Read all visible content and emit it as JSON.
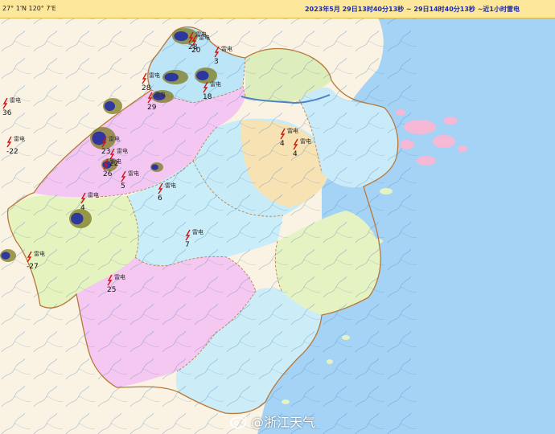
{
  "header": {
    "coordinates": "27° 1'N  120° 7'E",
    "timestamp": "2023年5月 29日13时40分13秒 ~ 29日14时40分13秒 ~近1小时雷电"
  },
  "watermark": {
    "text": "@浙江天气",
    "icon": "weibo-logo-icon"
  },
  "legend_word": "雷电",
  "colors": {
    "sea": "#a5d3f5",
    "land_outside": "#faf3e3",
    "hangzhou": "#f4c7f2",
    "huzhou": "#bde5f8",
    "jiaxing": "#ddedbc",
    "shaoxing": "#c7ebf7",
    "ningbo": "#c9ebf9",
    "quzhou": "#e5f3bf",
    "jinhua": "#c9edf9",
    "lishui": "#f4c8f0",
    "taizhou": "#e4f3c1",
    "wenzhou": "#ccedf8",
    "zhoushan": "#f5b8d5",
    "tan_zone": "#f6e2b2",
    "river": "#4d82c2",
    "border": "#b7783a",
    "lightning": "#d61212",
    "cluster_olive": "#7c7a1d",
    "cluster_blue": "#1521b0"
  },
  "strike_labels": [
    {
      "id": "l1",
      "text": "28"
    },
    {
      "id": "l2",
      "text": "28"
    },
    {
      "id": "l3",
      "text": "3"
    },
    {
      "id": "l4",
      "text": "18"
    },
    {
      "id": "l5",
      "text": "29"
    },
    {
      "id": "l6",
      "text": "20"
    },
    {
      "id": "l7",
      "text": "23"
    },
    {
      "id": "l8",
      "text": "22"
    },
    {
      "id": "l9",
      "text": "-22"
    },
    {
      "id": "l10",
      "text": "26"
    },
    {
      "id": "l11",
      "text": "4"
    },
    {
      "id": "l12",
      "text": "6"
    },
    {
      "id": "l13",
      "text": "5"
    },
    {
      "id": "l14",
      "text": "4"
    },
    {
      "id": "l15",
      "text": "4"
    },
    {
      "id": "l16",
      "text": "7"
    },
    {
      "id": "l17",
      "text": "-27"
    },
    {
      "id": "l18",
      "text": "25"
    },
    {
      "id": "l19",
      "text": "36"
    }
  ]
}
